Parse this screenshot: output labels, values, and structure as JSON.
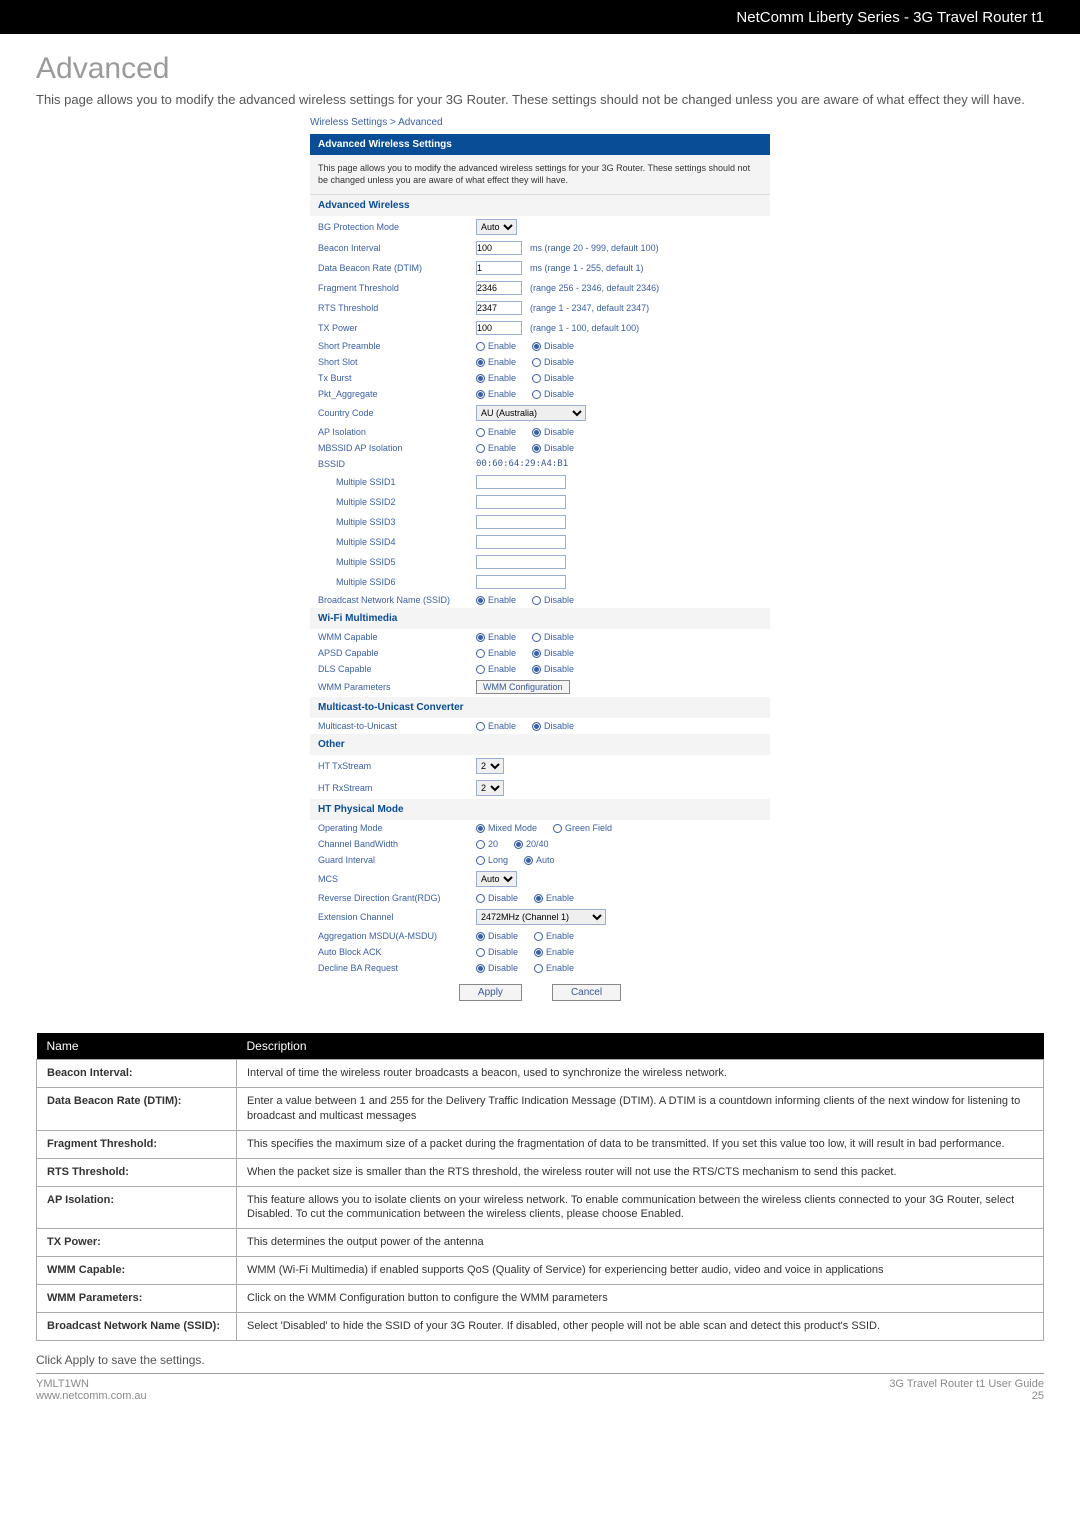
{
  "topbar": {
    "title": "NetComm Liberty Series - 3G Travel Router t1"
  },
  "heading": "Advanced",
  "intro": "This page allows you to modify the advanced wireless settings for your 3G Router. These settings should not be changed unless you are aware of what effect they will have.",
  "panel": {
    "crumbs": "Wireless Settings > Advanced",
    "barTitle": "Advanced Wireless Settings",
    "note": "This page allows you to modify the advanced wireless settings for your 3G Router. These settings should not be changed unless you are aware of what effect they will have.",
    "sections": {
      "advanced": "Advanced Wireless",
      "wifimm": "Wi-Fi Multimedia",
      "m2u": "Multicast-to-Unicast Converter",
      "other": "Other",
      "htphy": "HT Physical Mode"
    },
    "labels": {
      "bgProtection": "BG Protection Mode",
      "beaconInterval": "Beacon Interval",
      "dtim": "Data Beacon Rate (DTIM)",
      "fragment": "Fragment Threshold",
      "rts": "RTS Threshold",
      "txpower": "TX Power",
      "shortPreamble": "Short Preamble",
      "shortSlot": "Short Slot",
      "txBurst": "Tx Burst",
      "pktAgg": "Pkt_Aggregate",
      "country": "Country Code",
      "apIso": "AP Isolation",
      "mbssidIso": "MBSSID AP Isolation",
      "bssid": "BSSID",
      "mssid1": "Multiple SSID1",
      "mssid2": "Multiple SSID2",
      "mssid3": "Multiple SSID3",
      "mssid4": "Multiple SSID4",
      "mssid5": "Multiple SSID5",
      "mssid6": "Multiple SSID6",
      "broadcastSsid": "Broadcast Network Name (SSID)",
      "wmmCap": "WMM Capable",
      "apsdCap": "APSD Capable",
      "dlsCap": "DLS Capable",
      "wmmParams": "WMM Parameters",
      "m2uLbl": "Multicast-to-Unicast",
      "htTx": "HT TxStream",
      "htRx": "HT RxStream",
      "opMode": "Operating Mode",
      "chBw": "Channel BandWidth",
      "guard": "Guard Interval",
      "mcs": "MCS",
      "rdg": "Reverse Direction Grant(RDG)",
      "extCh": "Extension Channel",
      "amsdu": "Aggregation MSDU(A-MSDU)",
      "autoBA": "Auto Block ACK",
      "declineBA": "Decline BA Request"
    },
    "values": {
      "bgProtection": "Auto",
      "beaconInterval": "100",
      "beaconHint": "ms (range 20 - 999, default 100)",
      "dtim": "1",
      "dtimHint": "ms (range 1 - 255, default 1)",
      "fragment": "2346",
      "fragmentHint": "(range 256 - 2346, default 2346)",
      "rts": "2347",
      "rtsHint": "(range 1 - 2347, default 2347)",
      "txpower": "100",
      "txpowerHint": "(range 1 - 100, default 100)",
      "country": "AU (Australia)",
      "bssid": "00:60:64:29:A4:B1",
      "wmmBtn": "WMM Configuration",
      "htTx": "2",
      "htRx": "2",
      "mcs": "Auto",
      "extCh": "2472MHz (Channel 1)",
      "apply": "Apply",
      "cancel": "Cancel"
    },
    "radio": {
      "enable": "Enable",
      "disable": "Disable",
      "mixed": "Mixed Mode",
      "green": "Green Field",
      "bw20": "20",
      "bw2040": "20/40",
      "long": "Long",
      "auto": "Auto"
    }
  },
  "table": {
    "head": {
      "name": "Name",
      "desc": "Description"
    },
    "rows": [
      {
        "k": "Beacon Interval:",
        "v": "Interval of time the wireless router broadcasts a beacon, used to synchronize the wireless network."
      },
      {
        "k": "Data Beacon Rate (DTIM):",
        "v": "Enter a value between 1 and 255 for the Delivery Traffic Indication Message (DTIM). A DTIM is a countdown informing clients of the next window for listening to broadcast and multicast messages"
      },
      {
        "k": "Fragment Threshold:",
        "v": "This specifies the maximum size of a packet during the fragmentation of data to be transmitted. If you set this value too low, it will result in bad performance."
      },
      {
        "k": "RTS Threshold:",
        "v": "When the packet size is smaller than the RTS threshold, the wireless router will not use the RTS/CTS mechanism to send this packet."
      },
      {
        "k": "AP Isolation:",
        "v": "This feature allows you to isolate clients on your wireless network. To enable communication between the wireless clients connected to your 3G Router, select Disabled. To cut the communication between the wireless clients, please choose Enabled."
      },
      {
        "k": "TX Power:",
        "v": "This determines the output power of the antenna"
      },
      {
        "k": "WMM Capable:",
        "v": "WMM (Wi-Fi Multimedia) if enabled supports QoS (Quality of Service) for experiencing better audio, video and voice in applications"
      },
      {
        "k": "WMM Parameters:",
        "v": "Click on the WMM Configuration button to configure the WMM parameters"
      },
      {
        "k": "Broadcast Network Name (SSID):",
        "v": "Select 'Disabled' to hide the SSID of your 3G Router. If disabled, other people will not be able scan and detect this product's SSID."
      }
    ]
  },
  "applyNote": "Click Apply to save the settings.",
  "footer": {
    "leftTop": "YMLT1WN",
    "leftBottom": "www.netcomm.com.au",
    "rightTop": "3G Travel Router t1 User Guide",
    "rightBottom": "25"
  }
}
